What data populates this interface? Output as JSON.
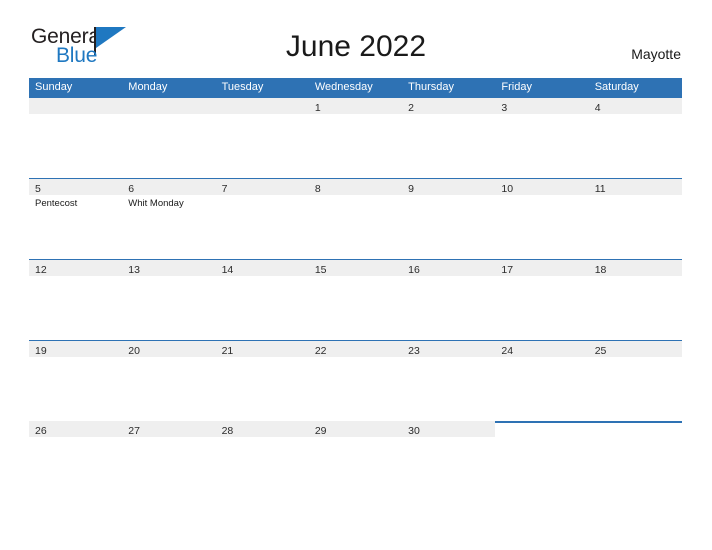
{
  "brand": {
    "word_one": "General",
    "word_two": "Blue"
  },
  "header": {
    "title": "June 2022",
    "region": "Mayotte"
  },
  "colors": {
    "header_blue": "#2e72b4",
    "brand_blue": "#1f78c1",
    "band_gray": "#efefef"
  },
  "calendar": {
    "weekdays": [
      "Sunday",
      "Monday",
      "Tuesday",
      "Wednesday",
      "Thursday",
      "Friday",
      "Saturday"
    ],
    "weeks": [
      [
        {
          "date": "",
          "events": []
        },
        {
          "date": "",
          "events": []
        },
        {
          "date": "",
          "events": []
        },
        {
          "date": "1",
          "events": []
        },
        {
          "date": "2",
          "events": []
        },
        {
          "date": "3",
          "events": []
        },
        {
          "date": "4",
          "events": []
        }
      ],
      [
        {
          "date": "5",
          "events": [
            "Pentecost"
          ]
        },
        {
          "date": "6",
          "events": [
            "Whit Monday"
          ]
        },
        {
          "date": "7",
          "events": []
        },
        {
          "date": "8",
          "events": []
        },
        {
          "date": "9",
          "events": []
        },
        {
          "date": "10",
          "events": []
        },
        {
          "date": "11",
          "events": []
        }
      ],
      [
        {
          "date": "12",
          "events": []
        },
        {
          "date": "13",
          "events": []
        },
        {
          "date": "14",
          "events": []
        },
        {
          "date": "15",
          "events": []
        },
        {
          "date": "16",
          "events": []
        },
        {
          "date": "17",
          "events": []
        },
        {
          "date": "18",
          "events": []
        }
      ],
      [
        {
          "date": "19",
          "events": []
        },
        {
          "date": "20",
          "events": []
        },
        {
          "date": "21",
          "events": []
        },
        {
          "date": "22",
          "events": []
        },
        {
          "date": "23",
          "events": []
        },
        {
          "date": "24",
          "events": []
        },
        {
          "date": "25",
          "events": []
        }
      ],
      [
        {
          "date": "26",
          "events": []
        },
        {
          "date": "27",
          "events": []
        },
        {
          "date": "28",
          "events": []
        },
        {
          "date": "29",
          "events": []
        },
        {
          "date": "30",
          "events": []
        },
        {
          "date": "",
          "events": []
        },
        {
          "date": "",
          "events": []
        }
      ]
    ]
  }
}
